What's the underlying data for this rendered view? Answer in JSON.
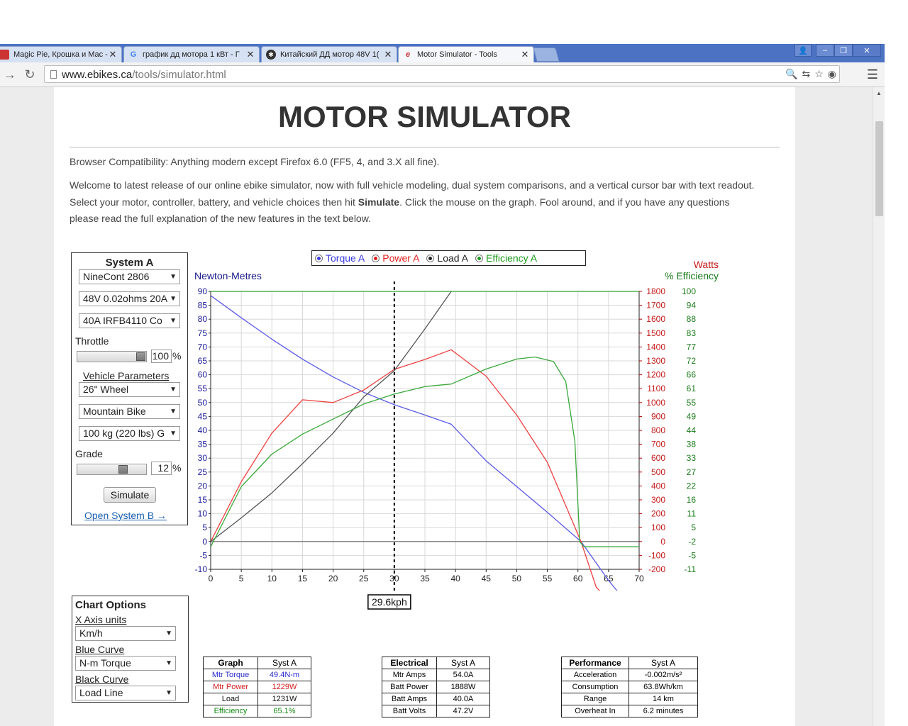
{
  "browser": {
    "tabs": [
      {
        "label": "Magic Pie, Крошка и Mac - a",
        "icon": "tab-favicon"
      },
      {
        "label": "график дд мотора 1 кВт - Г",
        "icon": "google-icon"
      },
      {
        "label": "Китайский ДД мотор 48V 1(",
        "icon": "forum-icon"
      },
      {
        "label": "Motor Simulator - Tools",
        "icon": "ebikes-icon"
      }
    ],
    "url_host": "www.ebikes.ca",
    "url_path": "/tools/simulator.html"
  },
  "page": {
    "title": "MOTOR SIMULATOR",
    "compat": "Browser Compatibility: Anything modern except Firefox 6.0 (FF5, 4, and 3.X all fine).",
    "intro_before": "Welcome to latest release of our online ebike simulator, now with full vehicle modeling, dual system comparisons, and a vertical cursor bar with text readout. Select your motor, controller, battery, and vehicle choices then hit ",
    "intro_bold": "Simulate",
    "intro_after": ". Click the mouse on the graph. Fool around, and if you have any questions please read the full explanation of the new features in the text below."
  },
  "system": {
    "title": "System A",
    "motor": "NineCont 2806",
    "battery": "48V 0.02ohms 20A",
    "controller": "40A IRFB4110 Co",
    "throttle_label": "Throttle",
    "throttle_value": "100",
    "throttle_fraction": 1.0,
    "pct": "%",
    "vehicle_label": "Vehicle Parameters",
    "wheel": "26\"  Wheel",
    "bike": "Mountain Bike",
    "mass": "100 kg (220 lbs) G",
    "grade_label": "Grade",
    "grade_value": "12",
    "grade_fraction": 0.7,
    "simulate_label": "Simulate",
    "open_b_label": "Open System B →"
  },
  "chart_options": {
    "title": "Chart Options",
    "x_units_label": "X Axis units",
    "x_units": "Km/h",
    "blue_label": "Blue Curve",
    "blue_value": "N-m Torque",
    "black_label": "Black Curve",
    "black_value": "Load Line"
  },
  "legend": [
    {
      "label": "Torque A",
      "color": "#3a3ae0"
    },
    {
      "label": "Power A",
      "color": "#e02020"
    },
    {
      "label": "Load A",
      "color": "#222222"
    },
    {
      "label": "Efficiency A",
      "color": "#1a9a1a"
    }
  ],
  "cursor_readout": "29.6kph",
  "tables": {
    "graph": {
      "headers": [
        "Graph",
        "Syst A"
      ],
      "rows": [
        {
          "label": "Mtr Torque",
          "value": "49.4N-m",
          "color": "#2a2ad0"
        },
        {
          "label": "Mtr Power",
          "value": "1229W",
          "color": "#d02020"
        },
        {
          "label": "Load",
          "value": "1231W",
          "color": "#111111"
        },
        {
          "label": "Efficiency",
          "value": "65.1%",
          "color": "#138a13"
        }
      ]
    },
    "electrical": {
      "headers": [
        "Electrical",
        "Syst A"
      ],
      "rows": [
        {
          "label": "Mtr Amps",
          "value": "54.0A"
        },
        {
          "label": "Batt Power",
          "value": "1888W"
        },
        {
          "label": "Batt Amps",
          "value": "40.0A"
        },
        {
          "label": "Batt Volts",
          "value": "47.2V"
        }
      ]
    },
    "performance": {
      "headers": [
        "Performance",
        "Syst A"
      ],
      "rows": [
        {
          "label": "Acceleration",
          "value": "-0.002m/s²"
        },
        {
          "label": "Consumption",
          "value": "63.8Wh/km"
        },
        {
          "label": "Range",
          "value": "14 km"
        },
        {
          "label": "Overheat In",
          "value": "6.2 minutes"
        }
      ]
    }
  },
  "chart_data": {
    "type": "line",
    "left_axis_label": "Newton-Metres",
    "right_axis_label_1": "Watts",
    "right_axis_label_2": "% Efficiency",
    "xlim": [
      0,
      70
    ],
    "ylim_left": [
      -10,
      90
    ],
    "ylim_power": [
      -200,
      1800
    ],
    "ylim_eff": [
      -11,
      100
    ],
    "x_ticks": [
      "0",
      "5",
      "10",
      "15",
      "20",
      "25",
      "30",
      "35",
      "40",
      "45",
      "50",
      "55",
      "60",
      "65",
      "70"
    ],
    "left_ticks": [
      "90",
      "85",
      "80",
      "75",
      "70",
      "65",
      "60",
      "55",
      "50",
      "45",
      "40",
      "35",
      "30",
      "25",
      "20",
      "15",
      "10",
      "5",
      "0",
      "-5",
      "-10"
    ],
    "power_ticks": [
      "1800",
      "1700",
      "1600",
      "1500",
      "1400",
      "1300",
      "1200",
      "1100",
      "1000",
      "900",
      "800",
      "700",
      "600",
      "500",
      "400",
      "300",
      "200",
      "100",
      "0",
      "-100",
      "-200"
    ],
    "eff_ticks": [
      "100",
      "94",
      "88",
      "83",
      "77",
      "72",
      "66",
      "61",
      "55",
      "49",
      "44",
      "38",
      "33",
      "27",
      "22",
      "16",
      "11",
      "5",
      "-2",
      "-5",
      "-11"
    ],
    "cursor_x": 30,
    "series": [
      {
        "name": "Torque A",
        "axis": "left",
        "color": "#5a5ae8",
        "x": [
          0,
          5,
          10,
          15,
          20,
          25,
          30,
          35,
          39.3,
          45,
          50,
          55,
          60.5,
          65,
          66.5
        ],
        "y": [
          88.5,
          80.5,
          72.8,
          65.6,
          59.2,
          53.7,
          49.2,
          45.5,
          42.2,
          29,
          19.8,
          10.5,
          0,
          -14,
          -18
        ]
      },
      {
        "name": "Power A",
        "axis": "power",
        "color": "#ee4040",
        "x": [
          0,
          5,
          10,
          15,
          20,
          25,
          30,
          35,
          39.3,
          45,
          50,
          55,
          60.5,
          63,
          63.7
        ],
        "y": [
          0,
          430,
          780,
          1020,
          1000,
          1090,
          1239,
          1310,
          1380,
          1190,
          910,
          570,
          0,
          -330,
          -360
        ]
      },
      {
        "name": "Load A",
        "axis": "power",
        "color": "#555555",
        "x": [
          0,
          5,
          10,
          15,
          20,
          25,
          30,
          35,
          39.3
        ],
        "y": [
          0,
          170,
          350,
          560,
          780,
          1040,
          1230,
          1530,
          1800
        ]
      },
      {
        "name": "Efficiency A",
        "axis": "eff",
        "color": "#3aa83a",
        "x": [
          0,
          5,
          10,
          15,
          20,
          25,
          30,
          35,
          39.3,
          45,
          50,
          53,
          56,
          58,
          59.5,
          60.3,
          61,
          70
        ],
        "y": [
          -2,
          22,
          35,
          43,
          49,
          55,
          59,
          62,
          63,
          69,
          73,
          73.8,
          72,
          64,
          40,
          0,
          -2,
          -2
        ]
      },
      {
        "name": "Top line",
        "axis": "eff",
        "color": "#2ca02c",
        "x": [
          0,
          70
        ],
        "y": [
          100,
          100
        ]
      }
    ]
  }
}
